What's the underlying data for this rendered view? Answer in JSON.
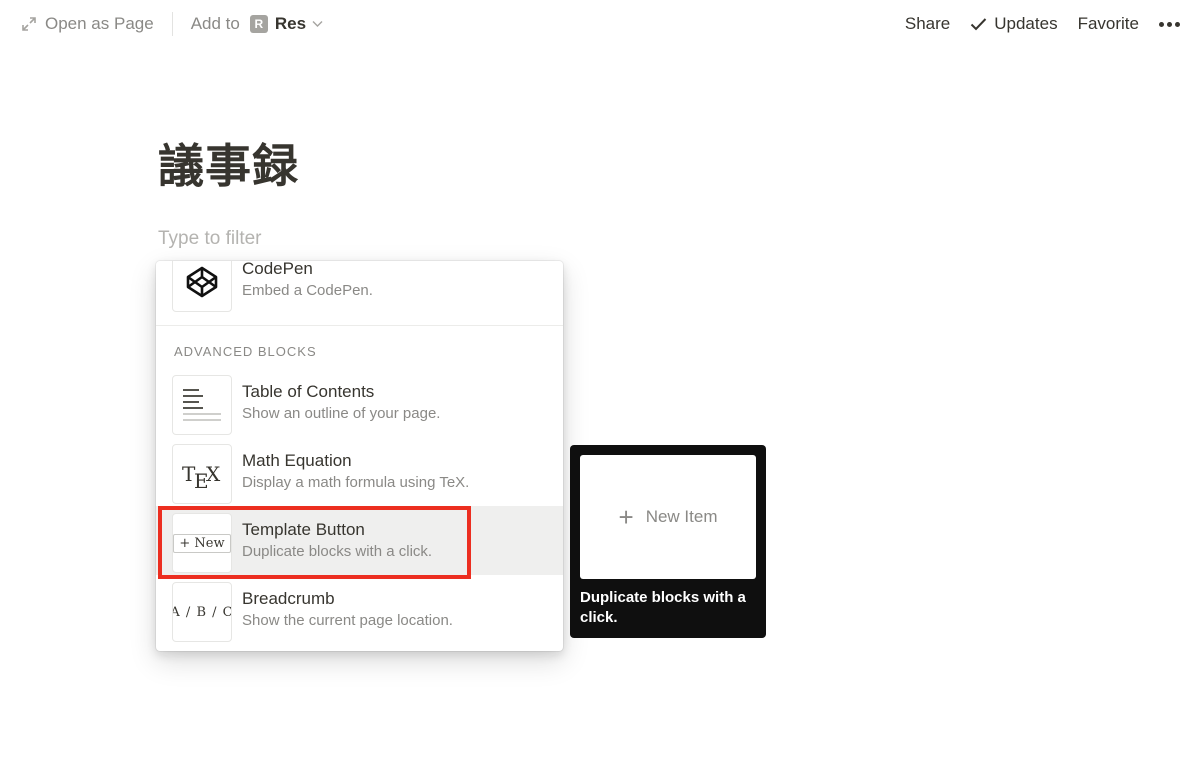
{
  "topbar": {
    "open_as_page": "Open as Page",
    "add_to": "Add to",
    "workspace_initial": "R",
    "workspace_name": "Res",
    "share": "Share",
    "updates": "Updates",
    "favorite": "Favorite"
  },
  "page": {
    "title": "議事録",
    "filter_placeholder": "Type to filter"
  },
  "menu": {
    "codepen": {
      "title": "CodePen",
      "desc": "Embed a CodePen."
    },
    "section_label": "ADVANCED BLOCKS",
    "items": [
      {
        "title": "Table of Contents",
        "desc": "Show an outline of your page."
      },
      {
        "title": "Math Equation",
        "desc": "Display a math formula using TeX."
      },
      {
        "title": "Template Button",
        "desc": "Duplicate blocks with a click."
      },
      {
        "title": "Breadcrumb",
        "desc": "Show the current page location."
      }
    ],
    "tex_icon": {
      "t": "T",
      "e": "E",
      "x": "X"
    },
    "template_icon_label": "+ New",
    "breadcrumb_icon_label": "A / B / C"
  },
  "preview": {
    "plus": "+",
    "button_label": "New Item",
    "caption": "Duplicate blocks with a click."
  },
  "colors": {
    "highlight": "#efefee",
    "annotation_red": "#ec2e20",
    "tooltip_bg": "#0f0f0f"
  }
}
